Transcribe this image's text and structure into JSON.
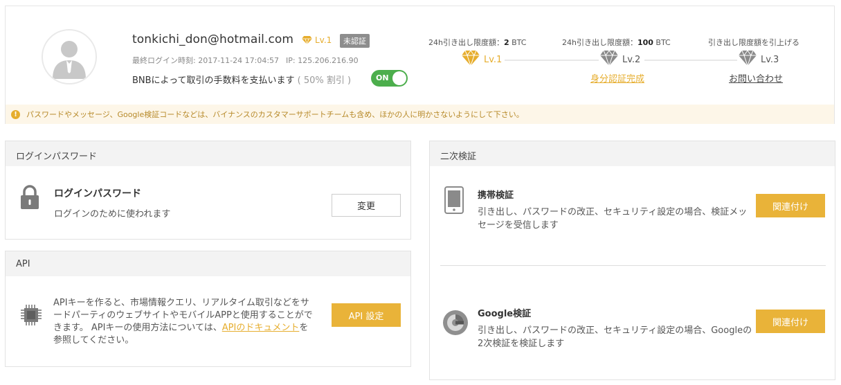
{
  "profile": {
    "email": "tonkichi_don@hotmail.com",
    "level": "Lv.1",
    "verify_badge": "未認証",
    "last_login_label": "最終ログイン時刻: 2017-11-24 17:04:57",
    "ip_label": "IP: 125.206.216.90",
    "bnb_text": "BNBによって取引の手数料を支払います",
    "bnb_discount": "( 50% 割引 )",
    "bnb_toggle": "ON"
  },
  "limits": {
    "lv1": {
      "label_prefix": "24h引き出し限度額：",
      "amount": "2",
      "unit": " BTC",
      "level": "Lv.1"
    },
    "lv2": {
      "label_prefix": "24h引き出し限度額：",
      "amount": "100",
      "unit": " BTC",
      "level": "Lv.2",
      "link": "身分認証完成"
    },
    "lv3": {
      "label": "引き出し限度額を引上げる",
      "level": "Lv.3",
      "link": "お問い合わせ"
    }
  },
  "warning": "パスワードやメッセージ、Google検証コードなどは、バイナンスのカスタマーサポートチームも含め、ほかの人に明かさないようにして下さい。",
  "login_panel": {
    "header": "ログインパスワード",
    "title": "ログインパスワード",
    "desc": "ログインのために使われます",
    "button": "変更"
  },
  "api_panel": {
    "header": "API",
    "desc_before": "APIキーを作ると、市場情報クエリ、リアルタイム取引などをサードパーティのウェブサイトやモバイルAPPと使用することができます。 APIキーの使用方法については、",
    "desc_link": "APIのドキュメント",
    "desc_after": "を参照してください。",
    "button": "API 設定"
  },
  "twofa_panel": {
    "header": "二次検証",
    "sms": {
      "title": "携帯検証",
      "desc": "引き出し、パスワードの改正、セキュリティ設定の場合、検証メッセージを受信します",
      "button": "関連付け"
    },
    "google": {
      "title": "Google検証",
      "desc": "引き出し、パスワードの改正、セキュリティ設定の場合、Googleの2次検証を検証します",
      "button": "関連付け"
    }
  },
  "colors": {
    "accent": "#e9b339",
    "toggle_on": "#4cae4c",
    "badge": "#8d8d8d"
  }
}
